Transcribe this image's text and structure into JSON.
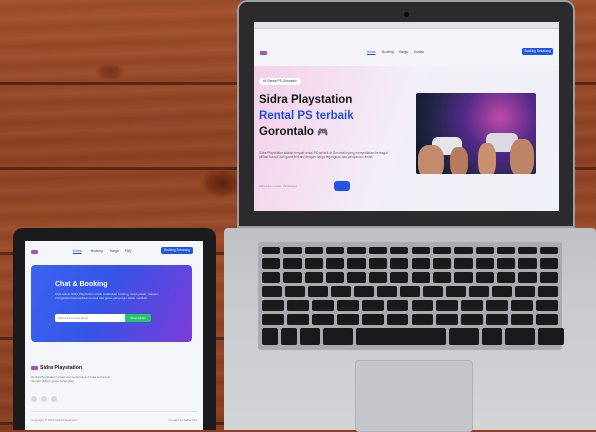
{
  "laptop_site": {
    "nav": {
      "links": [
        "Home",
        "Booking",
        "Harga",
        "Kontak"
      ],
      "cta": "Booking Sekarang"
    },
    "hero": {
      "badge": "#1 Rental PS Gorontalo",
      "title_line1": "Sidra Playstation",
      "title_line2": "Rental PS terbaik",
      "title_line3": "Gorontalo",
      "title_emoji": "🎮",
      "description": "Sidra Playstation adalah tempat rental PS terbaik di Gorontalo yang menyediakan berbagai pilihan konsol dan game terbaru dengan harga terjangkau dan pelayanan ramah.",
      "input_placeholder": "Masukkan nomor WhatsApp"
    }
  },
  "tablet_site": {
    "nav": {
      "links": [
        "Home",
        "Booking",
        "Harga",
        "FAQ"
      ],
      "cta": "Booking Sekarang"
    },
    "cta": {
      "title": "Chat & Booking",
      "description": "Chat admin Sidra Playstation untuk melakukan booking, tanya jawab, maupun mengetahui ketersediaan konsol dan game yang ingin kamu mainkan.",
      "input_placeholder": "Masukkan nama kamu",
      "button": "Chat Admin"
    },
    "footer": {
      "brand": "Sidra Playstation",
      "description": "Rental PlayStation terbaik dan terpercaya di kota Gorontalo dengan pilihan game terlengkap.",
      "copyright": "Copyright © 2023 Sidra Playstation",
      "credit": "Created by Sidra Dev"
    }
  },
  "colors": {
    "accent": "#1f56e8",
    "cta_green": "#27c46b",
    "wood": "#9c4a28"
  },
  "icons": [
    "logo-icon",
    "gamepad-emoji-icon",
    "social-icon"
  ]
}
